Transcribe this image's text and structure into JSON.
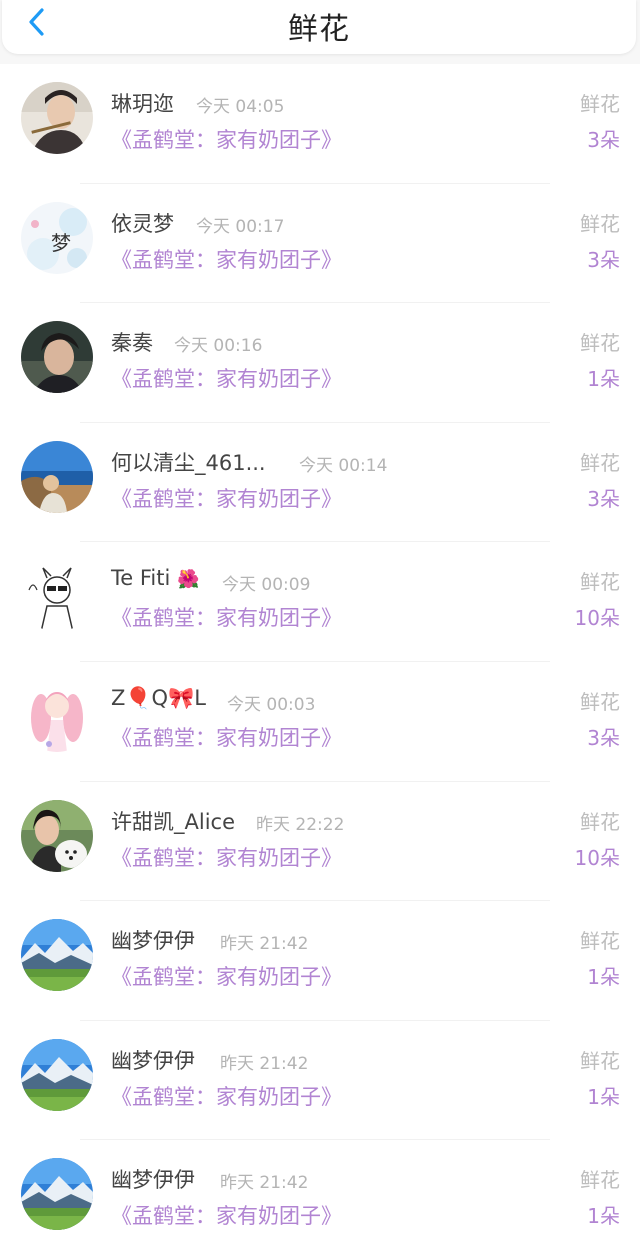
{
  "header": {
    "title": "鲜花",
    "back_icon": "chevron-left-icon"
  },
  "colors": {
    "accent": "#b184d2",
    "back": "#1e9bf5",
    "muted": "#b4b4b4"
  },
  "records": [
    {
      "name": "琳玥迩",
      "time": "今天 04:05",
      "book": "《孟鹤堂：家有奶团子》",
      "label": "鲜花",
      "count": "3朵"
    },
    {
      "name": "依灵梦",
      "time": "今天 00:17",
      "book": "《孟鹤堂：家有奶团子》",
      "label": "鲜花",
      "count": "3朵"
    },
    {
      "name": "秦奏",
      "time": "今天 00:16",
      "book": "《孟鹤堂：家有奶团子》",
      "label": "鲜花",
      "count": "1朵"
    },
    {
      "name": "何以清尘_461...",
      "time": "今天 00:14",
      "book": "《孟鹤堂：家有奶团子》",
      "label": "鲜花",
      "count": "3朵"
    },
    {
      "name": "Te Fiti",
      "name_emoji": "🌺",
      "time": "今天 00:09",
      "book": "《孟鹤堂：家有奶团子》",
      "label": "鲜花",
      "count": "10朵"
    },
    {
      "name": "Z🎈Q🎀L",
      "time": "今天 00:03",
      "book": "《孟鹤堂：家有奶团子》",
      "label": "鲜花",
      "count": "3朵"
    },
    {
      "name": "许甜凯_Alice",
      "time": "昨天 22:22",
      "book": "《孟鹤堂：家有奶团子》",
      "label": "鲜花",
      "count": "10朵"
    },
    {
      "name": "幽梦伊伊",
      "time": "昨天 21:42",
      "book": "《孟鹤堂：家有奶团子》",
      "label": "鲜花",
      "count": "1朵"
    },
    {
      "name": "幽梦伊伊",
      "time": "昨天 21:42",
      "book": "《孟鹤堂：家有奶团子》",
      "label": "鲜花",
      "count": "1朵"
    },
    {
      "name": "幽梦伊伊",
      "time": "昨天 21:42",
      "book": "《孟鹤堂：家有奶团子》",
      "label": "鲜花",
      "count": "1朵"
    }
  ]
}
